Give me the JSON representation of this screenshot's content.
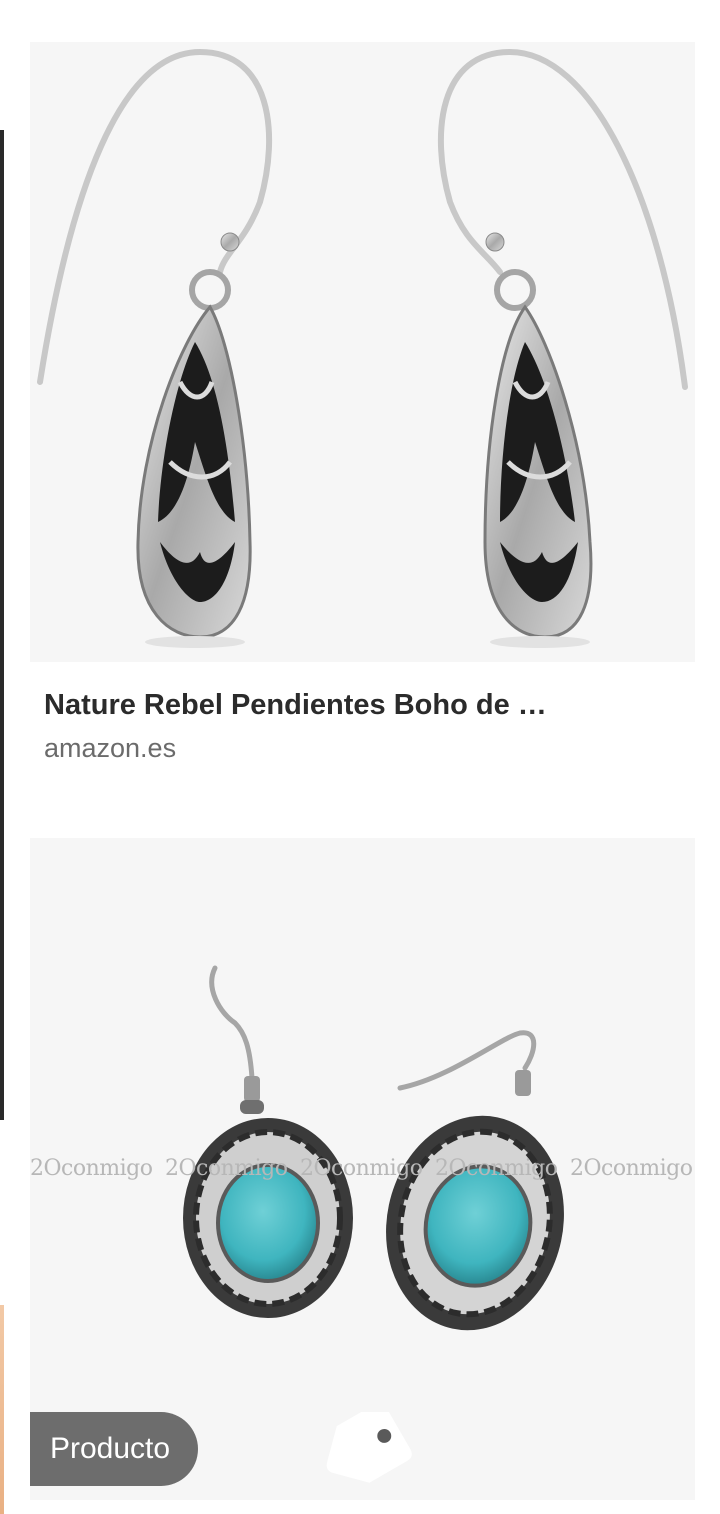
{
  "results": [
    {
      "title": "Nature Rebel Pendientes Boho de …",
      "source": "amazon.es",
      "image_icon": "filigree-teardrop-earrings"
    },
    {
      "watermark": "2Oconmigo",
      "badge_label": "Producto",
      "badge_icon": "tag-icon",
      "image_icon": "turquoise-oval-earrings"
    }
  ],
  "colors": {
    "image_background": "#f6f6f6",
    "title": "#2b2b2b",
    "source": "#6b6b6b",
    "badge_background": "#5a5a5a",
    "turquoise": "#3fb5bf"
  }
}
